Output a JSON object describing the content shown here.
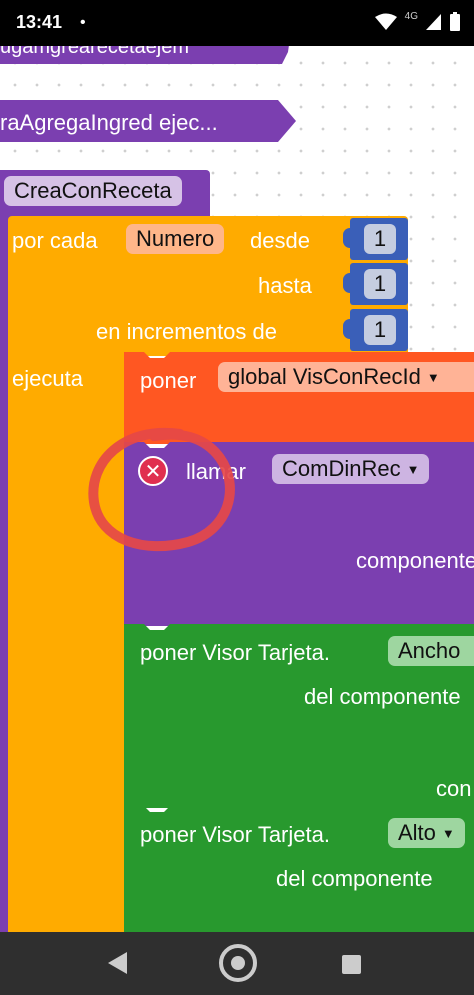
{
  "status": {
    "time": "13:41",
    "dot": "•",
    "network": "4G",
    "icons": [
      "wifi-icon",
      "signal-icon",
      "battery-icon"
    ]
  },
  "blocks": {
    "top_call_partial": "ugamgrearecetaejem",
    "second_call": "raAgregaIngred ejec...",
    "procedure_name": "CreaConReceta",
    "for_each": {
      "label": "por cada",
      "variable": "Numero",
      "from_label": "desde",
      "from_value": "1",
      "to_label": "hasta",
      "to_value": "1",
      "step_label": "en incrementos de",
      "step_value": "1",
      "do_label": "ejecuta"
    },
    "set_global": {
      "label": "poner",
      "variable": "global VisConRecId"
    },
    "call": {
      "label": "llamar",
      "procedure": "ComDinRec",
      "component_label": "componente"
    },
    "set_width": {
      "label": "poner Visor Tarjeta.",
      "property": "Ancho",
      "component_label": "del componente",
      "partial": "con"
    },
    "set_height": {
      "label": "poner Visor Tarjeta.",
      "property": "Alto",
      "component_label": "del componente"
    }
  },
  "colors": {
    "control": "#FFAB00",
    "procedure": "#7B3FB0",
    "math": "#3A5FB8",
    "variables": "#FF5722",
    "component": "#28992E",
    "annotation": "#E54848"
  }
}
